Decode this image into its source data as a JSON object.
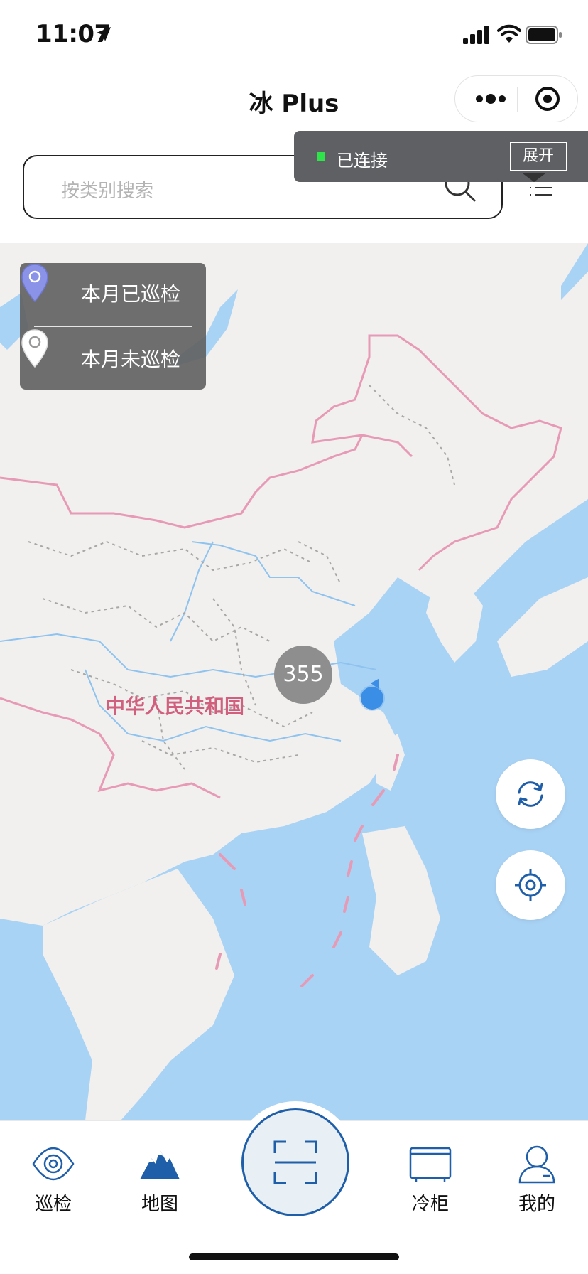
{
  "status_bar": {
    "time": "11:07"
  },
  "nav": {
    "title": "冰 Plus"
  },
  "search": {
    "placeholder": "按类别搜索"
  },
  "connection": {
    "status": "已连接",
    "expand_label": "展开",
    "status_color": "#2fe34a"
  },
  "legend": {
    "inspected": {
      "label": "本月已巡检",
      "pin_color": "#8a93e8"
    },
    "not_inspected": {
      "label": "本月未巡检",
      "pin_color": "#ffffff"
    }
  },
  "map": {
    "country_label": "中华人民共和国",
    "cluster_count": "355",
    "water_color": "#a9d3f5",
    "land_color": "#f1f0ee",
    "border_color": "#e79ab5"
  },
  "tabs": [
    {
      "label": "巡检",
      "icon": "inspection-eye-icon"
    },
    {
      "label": "地图",
      "icon": "map-mountain-icon",
      "active": true
    },
    {
      "label": "",
      "icon": "scan-icon"
    },
    {
      "label": "冷柜",
      "icon": "freezer-icon"
    },
    {
      "label": "我的",
      "icon": "user-profile-icon"
    }
  ],
  "accent_color": "#1f5ea8"
}
